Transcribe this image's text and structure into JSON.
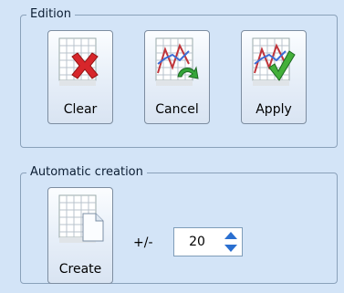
{
  "edition": {
    "title": "Edition",
    "buttons": [
      {
        "label": "Clear",
        "icon": "chart-clear-icon"
      },
      {
        "label": "Cancel",
        "icon": "chart-undo-icon"
      },
      {
        "label": "Apply",
        "icon": "chart-apply-icon"
      }
    ]
  },
  "automatic": {
    "title": "Automatic creation",
    "create_label": "Create",
    "create_icon": "grid-document-icon",
    "plusminus": "+/-",
    "spin_value": "20"
  },
  "colors": {
    "panel_background": "#d3e4f7",
    "group_border": "#8aa1ba",
    "spin_arrow": "#2a6fd0"
  }
}
